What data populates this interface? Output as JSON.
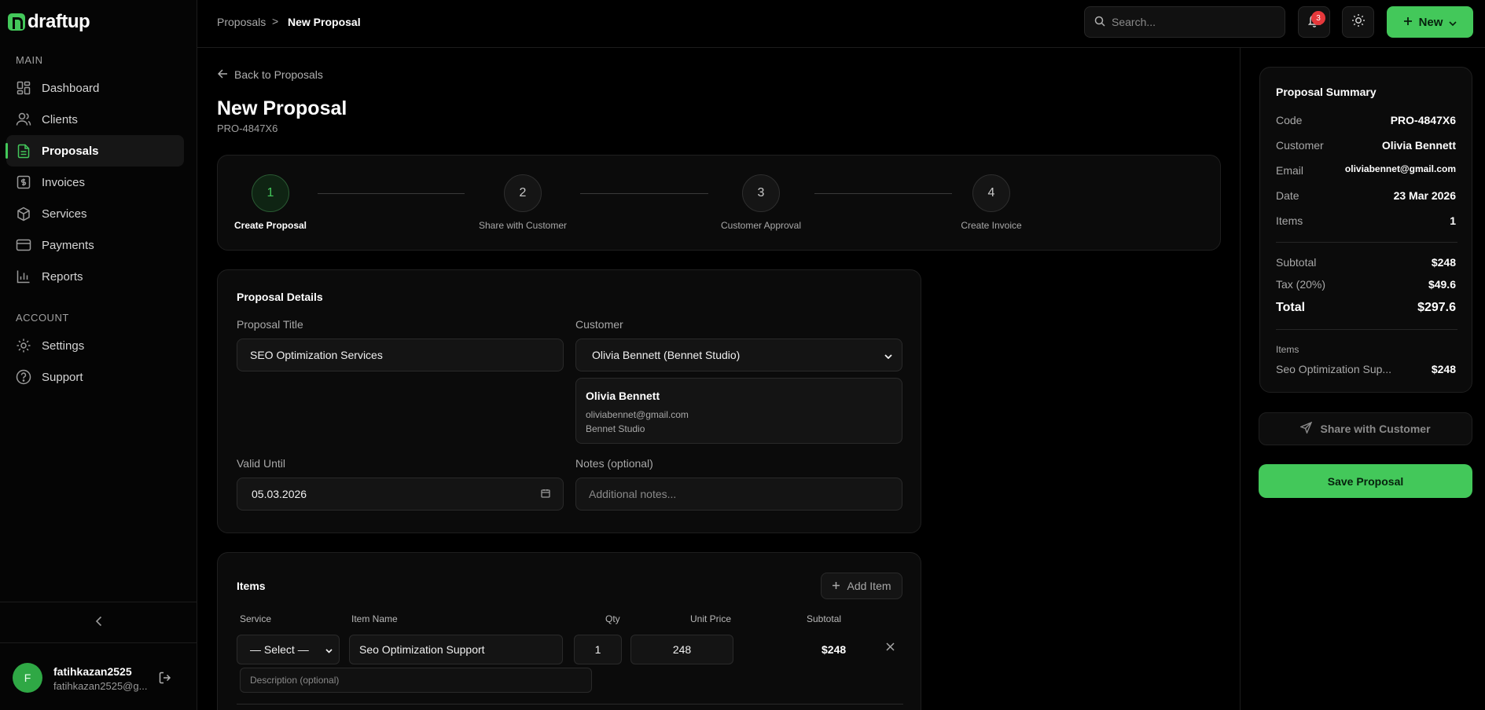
{
  "app": {
    "name": "draftup"
  },
  "sidebar": {
    "main_label": "MAIN",
    "items": [
      {
        "label": "Dashboard",
        "icon": "dashboard-icon"
      },
      {
        "label": "Clients",
        "icon": "users-icon"
      },
      {
        "label": "Proposals",
        "icon": "file-icon",
        "active": true
      },
      {
        "label": "Invoices",
        "icon": "invoice-icon"
      },
      {
        "label": "Services",
        "icon": "box-icon"
      },
      {
        "label": "Payments",
        "icon": "card-icon"
      },
      {
        "label": "Reports",
        "icon": "bar-chart-icon"
      }
    ],
    "account_label": "ACCOUNT",
    "account_items": [
      {
        "label": "Settings",
        "icon": "gear-icon"
      },
      {
        "label": "Support",
        "icon": "help-icon"
      }
    ],
    "user": {
      "initial": "F",
      "name": "fatihkazan2525",
      "email": "fatihkazan2525@g..."
    }
  },
  "header": {
    "breadcrumb": [
      "Proposals",
      "New Proposal"
    ],
    "breadcrumb_sep": ">",
    "search_placeholder": "Search...",
    "notification_count": "3",
    "new_label": "New"
  },
  "page": {
    "back_label": "Back to Proposals",
    "title": "New Proposal",
    "code": "PRO-4847X6"
  },
  "stepper": {
    "current": 1,
    "steps": [
      {
        "number": "1",
        "label": "Create Proposal"
      },
      {
        "number": "2",
        "label": "Share with Customer"
      },
      {
        "number": "3",
        "label": "Customer Approval"
      },
      {
        "number": "4",
        "label": "Create Invoice"
      }
    ]
  },
  "details": {
    "title": "Proposal Details",
    "proposal_title_label": "Proposal Title",
    "proposal_title_value": "SEO Optimization Services",
    "customer_label": "Customer",
    "customer_value": "Olivia Bennett (Bennet Studio)",
    "customer_info": {
      "name": "Olivia Bennett",
      "email": "oliviabennet@gmail.com",
      "company": "Bennet Studio"
    },
    "valid_until_label": "Valid Until",
    "valid_until_value": "05.03.2026",
    "notes_label": "Notes (optional)",
    "notes_placeholder": "Additional notes..."
  },
  "items": {
    "title": "Items",
    "add_label": "Add Item",
    "columns": [
      "Service",
      "Item Name",
      "Qty",
      "Unit Price",
      "Subtotal"
    ],
    "rows": [
      {
        "service": "— Select —",
        "name": "Seo Optimization Support",
        "qty": "1",
        "unit_price": "248",
        "subtotal": "$248",
        "description_placeholder": "Description (optional)"
      }
    ]
  },
  "summary": {
    "title": "Proposal Summary",
    "fields": [
      {
        "label": "Code",
        "value": "PRO-4847X6"
      },
      {
        "label": "Customer",
        "value": "Olivia Bennett"
      },
      {
        "label": "Email",
        "value": "oliviabennet@gmail.com"
      },
      {
        "label": "Date",
        "value": "23 Mar 2026"
      },
      {
        "label": "Items",
        "value": "1"
      }
    ],
    "subtotal_label": "Subtotal",
    "subtotal_value": "$248",
    "tax_label": "Tax (20%)",
    "tax_value": "$49.6",
    "total_label": "Total",
    "total_value": "$297.6",
    "items_label": "Items",
    "items_list": [
      {
        "name": "Seo Optimization Sup...",
        "amount": "$248"
      }
    ],
    "share_label": "Share with Customer",
    "save_label": "Save Proposal"
  },
  "colors": {
    "accent": "#43c85a",
    "badge": "#e5383b",
    "background": "#000000",
    "card": "#0b0b0b"
  }
}
